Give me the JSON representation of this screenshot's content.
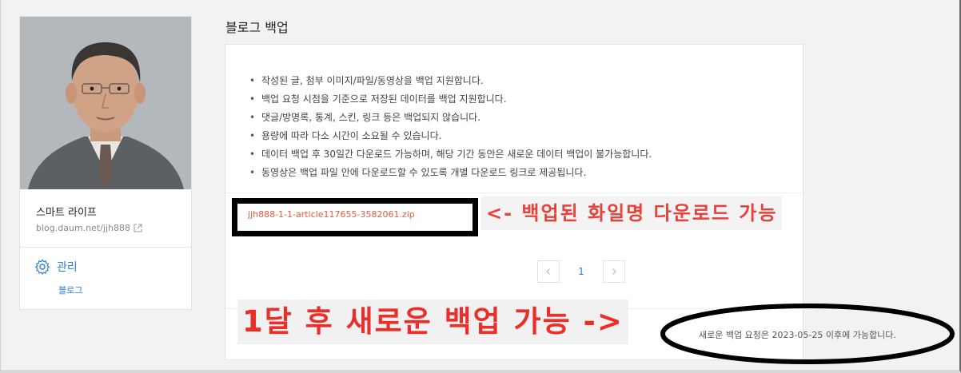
{
  "sidebar": {
    "blog_name": "스마트 라이프",
    "blog_url": "blog.daum.net/jjh888",
    "manage_label": "관리",
    "sub_item": "블로그"
  },
  "main": {
    "page_title": "블로그 백업",
    "notes": [
      "작성된 글, 첨부 이미지/파일/동영상을 백업 지원합니다.",
      "백업 요청 시점을 기준으로 저장된 데이터를 백업 지원합니다.",
      "댓글/방명록, 통계, 스킨, 링크 등은 백업되지 않습니다.",
      "용량에 따라 다소 시간이 소요될 수 있습니다.",
      "데이터 백업 후 30일간 다운로드 가능하며, 해당 기간 동안은 새로운 데이터 백업이 불가능합니다.",
      "동영상은 백업 파일 안에 다운로드할 수 있도록 개별 다운로드 링크로 제공됩니다."
    ],
    "file_name": "jjh888-1-1-article117655-3582061.zip",
    "pagination": {
      "current_page": "1"
    },
    "notice": "새로운 백업 요청은 2023-05-25 이후에 가능합니다."
  },
  "annotations": {
    "download_note": "<- 백업된 화일명 다운로드 가능",
    "next_backup_note": "1달 후 새로운 백업 가능 ->"
  },
  "colors": {
    "link": "#2e7fd0",
    "file_link": "#e25a40",
    "annotation_red": "#e8403a"
  }
}
